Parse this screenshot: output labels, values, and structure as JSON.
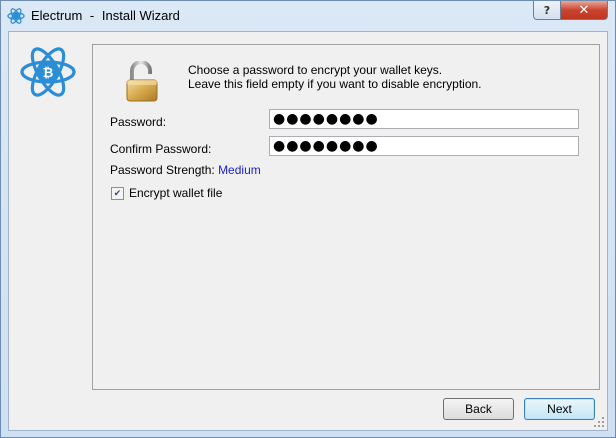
{
  "window": {
    "app_name": "Electrum",
    "separator": "-",
    "title": "Install Wizard",
    "help_glyph": "?",
    "close_glyph": "✕"
  },
  "icons": {
    "app": "electrum-logo-icon",
    "logo": "electrum-bitcoin-atom-logo",
    "lock": "padlock-open-icon",
    "checkmark": "check-icon"
  },
  "intro": {
    "line1": "Choose a password to encrypt your wallet keys.",
    "line2": "Leave this field empty if you want to disable encryption."
  },
  "form": {
    "password_label": "Password:",
    "password_value": "●●●●●●●●",
    "confirm_label": "Confirm Password:",
    "confirm_value": "●●●●●●●●",
    "strength_label": "Password Strength:",
    "strength_value": "Medium",
    "encrypt_label": "Encrypt wallet file",
    "encrypt_checked": true
  },
  "buttons": {
    "back": "Back",
    "next": "Next"
  },
  "colors": {
    "logo_blue": "#2b8dd6",
    "strength_text": "#1a22c9",
    "close_red": "#c8442f"
  }
}
